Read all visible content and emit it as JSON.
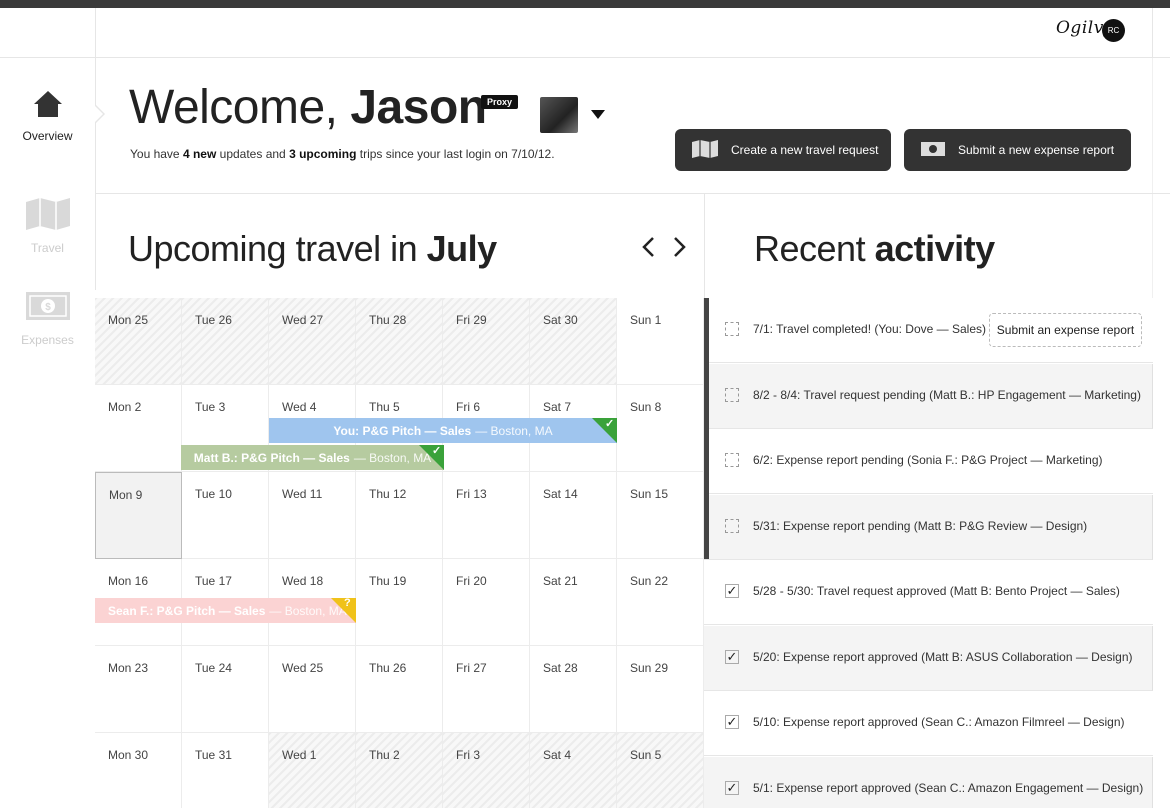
{
  "header": {
    "brand": "Ogilvy",
    "user_initials": "RC"
  },
  "sidebar": {
    "items": [
      {
        "label": "Overview",
        "icon": "home-icon",
        "active": true
      },
      {
        "label": "Travel",
        "icon": "map-icon",
        "active": false
      },
      {
        "label": "Expenses",
        "icon": "dollar-bill-icon",
        "active": false
      }
    ]
  },
  "welcome": {
    "greeting": "Welcome,",
    "name": "Jason",
    "proxy_badge": "Proxy",
    "sub_prefix": "You have",
    "new_count": "4 new",
    "sub_mid": "updates and",
    "upcoming_count": "3 upcoming",
    "sub_suffix": "trips since your last login on 7/10/12."
  },
  "actions": {
    "travel_button": "Create a new travel request",
    "expense_button": "Submit a new expense report"
  },
  "upcoming": {
    "title_prefix": "Upcoming travel in",
    "month": "July"
  },
  "calendar": {
    "weeks": [
      [
        "Mon 25",
        "Tue 26",
        "Wed 27",
        "Thu 28",
        "Fri 29",
        "Sat 30",
        "Sun 1"
      ],
      [
        "Mon 2",
        "Tue 3",
        "Wed 4",
        "Thu 5",
        "Fri 6",
        "Sat 7",
        "Sun 8"
      ],
      [
        "Mon 9",
        "Tue 10",
        "Wed 11",
        "Thu 12",
        "Fri 13",
        "Sat 14",
        "Sun 15"
      ],
      [
        "Mon 16",
        "Tue 17",
        "Wed 18",
        "Thu 19",
        "Fri 20",
        "Sat 21",
        "Sun 22"
      ],
      [
        "Mon 23",
        "Tue 24",
        "Wed 25",
        "Thu 26",
        "Fri 27",
        "Sat 28",
        "Sun 29"
      ],
      [
        "Mon 30",
        "Tue 31",
        "Wed 1",
        "Thu 2",
        "Fri 3",
        "Sat 4",
        "Sun 5"
      ]
    ],
    "events": [
      {
        "title": "You: P&G Pitch — Sales",
        "location": "— Boston, MA",
        "status": "approved"
      },
      {
        "title": "Matt B.: P&G Pitch — Sales",
        "location": "— Boston, MA",
        "status": "approved"
      },
      {
        "title": "Sean F.: P&G Pitch — Sales",
        "location": "— Boston, MA",
        "status": "pending"
      }
    ],
    "status_marks": {
      "approved": "✓",
      "pending": "?"
    }
  },
  "activity": {
    "title_prefix": "Recent",
    "title_bold": "activity",
    "items": [
      {
        "text": "7/1: Travel completed! (You: Dove — Sales)",
        "done": false,
        "action": "Submit an expense report"
      },
      {
        "text": "8/2 - 8/4: Travel request pending  (Matt B.: HP Engagement — Marketing)",
        "done": false
      },
      {
        "text": "6/2: Expense report pending (Sonia F.: P&G Project — Marketing)",
        "done": false
      },
      {
        "text": "5/31: Expense report pending (Matt B: P&G Review — Design)",
        "done": false
      },
      {
        "text": "5/28 - 5/30: Travel request approved  (Matt B: Bento Project — Sales)",
        "done": true
      },
      {
        "text": "5/20: Expense report approved  (Matt B: ASUS Collaboration — Design)",
        "done": true
      },
      {
        "text": "5/10: Expense report approved  (Sean C.: Amazon Filmreel — Design)",
        "done": true
      },
      {
        "text": "5/1: Expense report approved  (Sean C.: Amazon Engagement — Design)",
        "done": true
      }
    ],
    "check_mark": "✓"
  },
  "colors": {
    "approved": "#3aa23a",
    "pending": "#f0c21a",
    "event_blue": "#9fc5ee",
    "event_green": "#b6cba0",
    "event_pink": "#fbd3d3"
  }
}
